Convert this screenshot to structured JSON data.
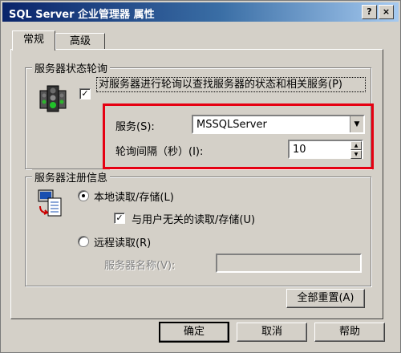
{
  "window": {
    "title": "SQL Server 企业管理器 属性",
    "help_glyph": "?",
    "close_glyph": "×"
  },
  "tabs": [
    {
      "label": "常规",
      "active": true
    },
    {
      "label": "高级",
      "active": false
    }
  ],
  "polling_group": {
    "title": "服务器状态轮询",
    "checkbox_label": "对服务器进行轮询以查找服务器的状态和相关服务(P)",
    "checked": true,
    "service_label": "服务(S):",
    "service_value": "MSSQLServer",
    "interval_label": "轮询间隔（秒）(I):",
    "interval_value": "10"
  },
  "registration_group": {
    "title": "服务器注册信息",
    "local_label": "本地读取/存储(L)",
    "local_selected": true,
    "user_independent_label": "与用户无关的读取/存储(U)",
    "user_independent_checked": true,
    "remote_label": "远程读取(R)",
    "remote_selected": false,
    "server_name_label": "服务器名称(V):",
    "server_name_value": ""
  },
  "buttons": {
    "reset_all": "全部重置(A)",
    "ok": "确定",
    "cancel": "取消",
    "help": "帮助"
  },
  "annotation": {
    "highlight_color": "#e60012"
  }
}
